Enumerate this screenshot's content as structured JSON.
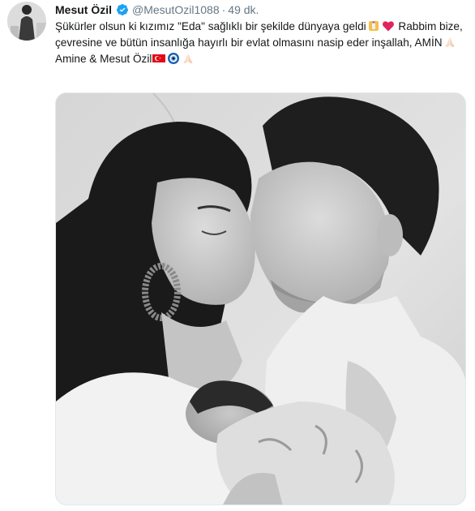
{
  "tweet": {
    "author_name": "Mesut Özil",
    "handle": "@MesutOzil1088",
    "separator": "·",
    "time": "49 dk.",
    "line1_a": "Şükürler olsun ki kızımız \"Eda\" sağlıklı bir şekilde dünyaya geldi",
    "line1_b": " Rabbim bize, çevresine ve bütün insanlığa hayırlı bir evlat olmasını nasip eder inşallah, AMİN",
    "line2": "Amine & Mesut Özil",
    "icons": {
      "verified": "verified-badge-icon",
      "baby_bottle": "baby-bottle-emoji",
      "heart": "red-heart-emoji",
      "praying": "praying-hands-emoji",
      "flag": "turkey-flag-emoji",
      "evil_eye": "nazar-amulet-emoji"
    },
    "colors": {
      "name": "#14171a",
      "secondary": "#657786",
      "verified": "#1da1f2",
      "heart": "#e0245e",
      "flag": "#e30a17"
    }
  }
}
